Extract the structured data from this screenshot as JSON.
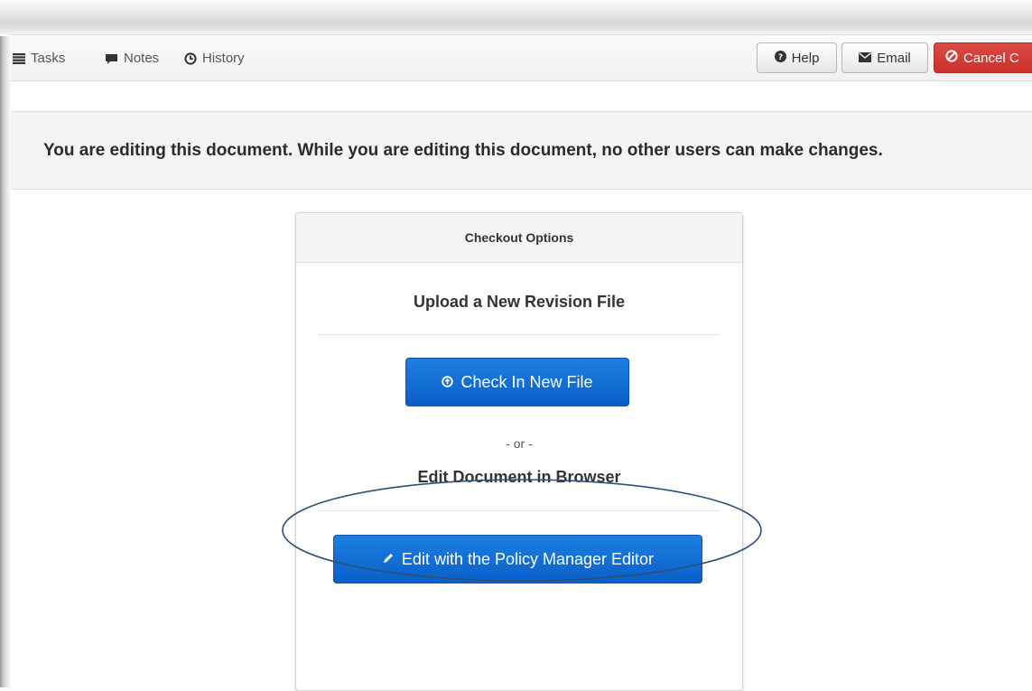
{
  "toolbar": {
    "tasks_label": "Tasks",
    "notes_label": "Notes",
    "history_label": "History",
    "help_label": "Help",
    "email_label": "Email",
    "cancel_label": "Cancel C"
  },
  "notice": {
    "text": "You are editing this document. While you are editing this document, no other users can make changes."
  },
  "panel": {
    "heading": "Checkout Options",
    "upload_title": "Upload a New Revision File",
    "check_in_label": "Check In New File",
    "or_text": "- or -",
    "edit_title": "Edit Document in Browser",
    "edit_button_label": "Edit with the Policy Manager Editor"
  },
  "colors": {
    "primary": "#0a5fc9",
    "danger": "#c9302c",
    "annotation": "#2a4f7a"
  },
  "icons": {
    "tasks": "list-icon",
    "notes": "comment-icon",
    "history": "clock-icon",
    "help": "question-circle-icon",
    "email": "envelope-icon",
    "cancel": "ban-icon",
    "check_in": "upload-circle-icon",
    "edit": "pencil-icon"
  }
}
